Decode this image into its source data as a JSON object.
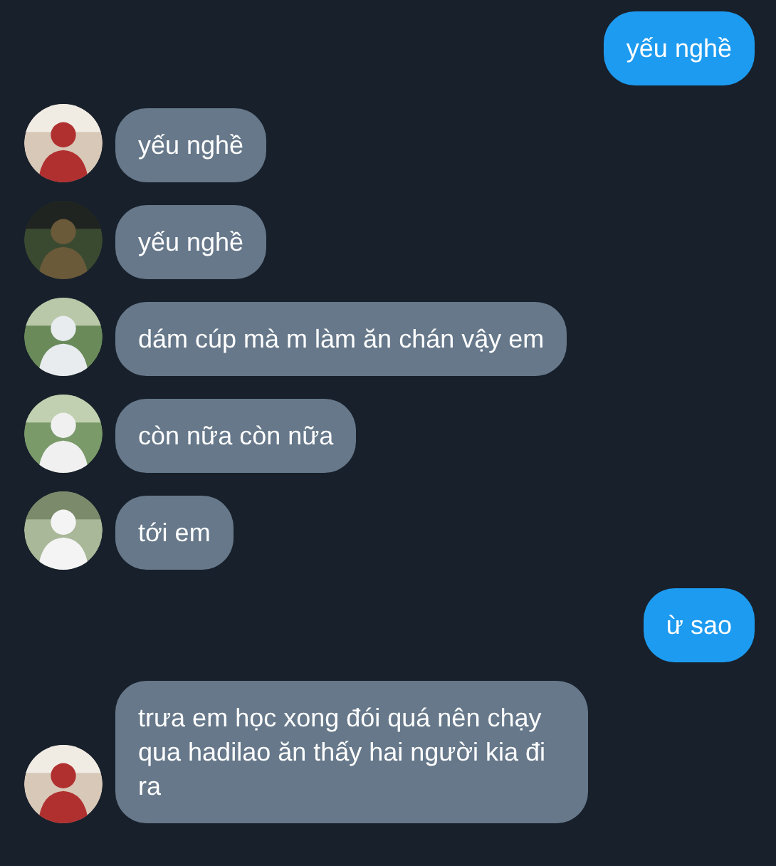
{
  "messages": [
    {
      "kind": "out",
      "text": "yếu nghề"
    },
    {
      "kind": "in",
      "text": "yếu nghề"
    },
    {
      "kind": "in",
      "text": "yếu nghề"
    },
    {
      "kind": "in",
      "text": "dám cúp mà m làm ăn chán vậy em"
    },
    {
      "kind": "in",
      "text": "còn nữa còn nữa"
    },
    {
      "kind": "in",
      "text": "tới em"
    },
    {
      "kind": "out",
      "text": "ừ sao"
    },
    {
      "kind": "in",
      "text": "trưa em học xong đói quá nên chạy qua hadilao ăn thấy hai người kia đi ra"
    }
  ]
}
